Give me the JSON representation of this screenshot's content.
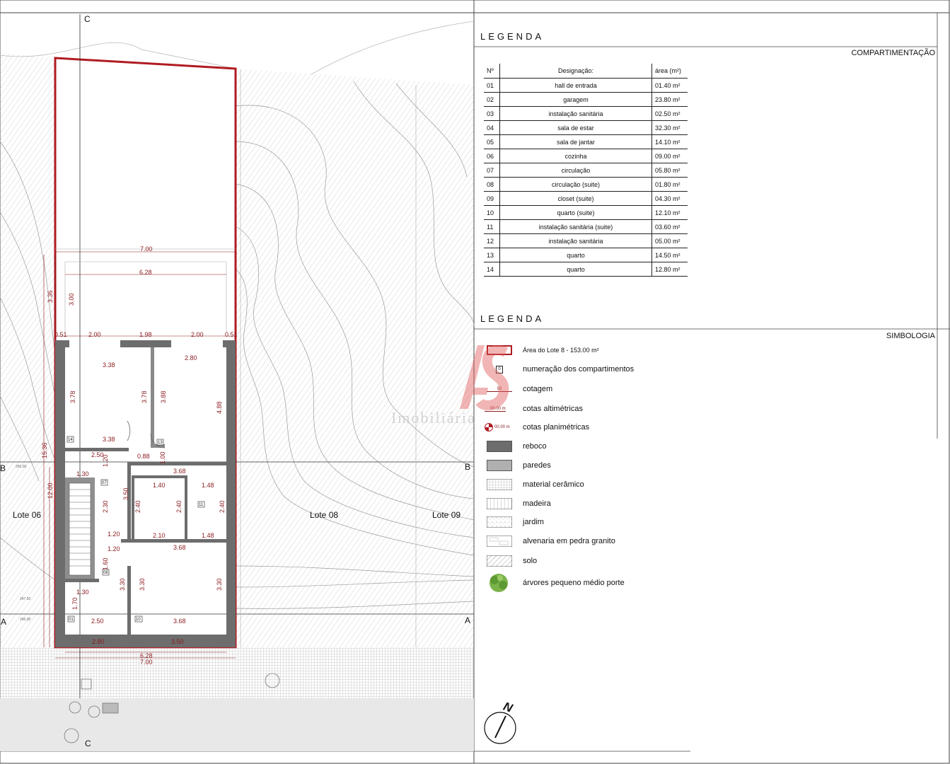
{
  "plan": {
    "section_marks": {
      "c": "C",
      "b": "B",
      "a": "A"
    },
    "lots": {
      "lot_06": "Lote 06",
      "lot_08": "Lote 08",
      "lot_09": "Lote 09"
    },
    "level_labels": {
      "l250": "250.00",
      "l247": "247.50",
      "l245": "245.00"
    },
    "room_tags": {
      "t01": "01",
      "t10": "10",
      "t11": "11",
      "t13": "13",
      "t14": "14",
      "t07": "07",
      "t08": "08"
    },
    "dimensions": {
      "d700_top": "7.00",
      "d628_top": "6.28",
      "d336": "3.36",
      "d300": "3.00",
      "d051_l": "0.51",
      "d200_a": "2.00",
      "d198": "1.98",
      "d200_b": "2.00",
      "d051_r": "0.51",
      "d338_a": "3.38",
      "d280": "2.80",
      "d378_a": "3.78",
      "d378_b": "3.78",
      "d388": "3.88",
      "d488": "4.88",
      "d338_b": "3.38",
      "d250_a": "2.50",
      "d088": "0.88",
      "d100": "1.00",
      "d1536": "15.36",
      "d130_a": "1.30",
      "d120_a": "1.20",
      "d368_a": "3.68",
      "d140": "1.40",
      "d148_a": "1.48",
      "d1200": "12.00",
      "d350": "3.50",
      "d230": "2.30",
      "d240_a": "2.40",
      "d240_b": "2.40",
      "d240_c": "2.40",
      "d120_b": "1.20",
      "d210": "2.10",
      "d148_b": "1.48",
      "d120_c": "1.20",
      "d368_b": "3.68",
      "d160": "1.60",
      "d330_a": "3.30",
      "d330_b": "3.30",
      "d330_c": "3.30",
      "d130_b": "1.30",
      "d170": "1.70",
      "d250_b": "2.50",
      "d368_c": "3.68",
      "d280_b": "2.80",
      "d350_b": "3.50",
      "d628_bot": "6.28",
      "d700_bot": "7.00"
    },
    "north": "N"
  },
  "rooms_panel": {
    "title": "LEGENDA",
    "subtitle": "COMPARTIMENTAÇÃO",
    "headers": {
      "num": "Nº",
      "name": "Designação:",
      "area": "área (m²)"
    },
    "rows": [
      {
        "num": "01",
        "name": "hall de entrada",
        "area": "01.40  m²"
      },
      {
        "num": "02",
        "name": "garagem",
        "area": "23.80  m²"
      },
      {
        "num": "03",
        "name": "instalação sanitária",
        "area": "02.50  m²"
      },
      {
        "num": "04",
        "name": "sala de estar",
        "area": "32.30  m²"
      },
      {
        "num": "05",
        "name": "sala de jantar",
        "area": "14.10  m²"
      },
      {
        "num": "06",
        "name": "cozinha",
        "area": "09.00  m²"
      },
      {
        "num": "07",
        "name": "circulação",
        "area": "05.80  m²"
      },
      {
        "num": "08",
        "name": "circulação (suite)",
        "area": "01.80  m²"
      },
      {
        "num": "09",
        "name": "closet (suite)",
        "area": "04.30  m²"
      },
      {
        "num": "10",
        "name": "quarto (suite)",
        "area": "12.10  m²"
      },
      {
        "num": "11",
        "name": "instalação sanitária (suite)",
        "area": "03.60  m²"
      },
      {
        "num": "12",
        "name": "instalação sanitária",
        "area": "05.00  m²"
      },
      {
        "num": "13",
        "name": "quarto",
        "area": "14.50  m²"
      },
      {
        "num": "14",
        "name": "quarto",
        "area": "12.80  m²"
      }
    ]
  },
  "symbols_panel": {
    "title": "LEGENDA",
    "subtitle": "SIMBOLOGIA",
    "items": {
      "lot_area": "Área do Lote 8 - 153.00 m²",
      "room_numbering": "numeração dos compartimentos",
      "room_numbering_sym": "0",
      "dimensioning": "cotagem",
      "dimensioning_sym": "92",
      "alt_levels": "cotas altimétricas",
      "alt_levels_sym": "00.00 m",
      "plan_levels": "cotas planimétricas",
      "plan_levels_sym": "00.00 m",
      "plaster": "reboco",
      "walls": "paredes",
      "ceramic": "material cerâmico",
      "wood": "madeira",
      "garden": "jardim",
      "granite": "alvenaria em pedra granito",
      "soil": "solo",
      "trees": "árvores pequeno médio porte"
    }
  },
  "watermark": {
    "brand": "Imobiliária"
  },
  "colors": {
    "lot_border": "#b01b22",
    "dimension": "#8a1a1e",
    "wall_fill": "#6d6d6d",
    "watermark": "#e05a5a"
  }
}
